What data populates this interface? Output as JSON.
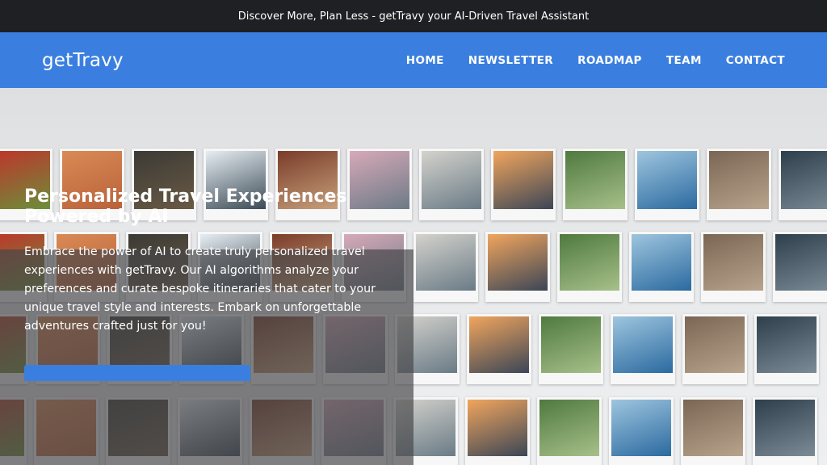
{
  "announcement": "Discover More, Plan Less - getTravy your AI-Driven Travel Assistant",
  "brand": "getTravy",
  "nav": [
    "HOME",
    "NEWSLETTER",
    "ROADMAP",
    "TEAM",
    "CONTACT"
  ],
  "hero": {
    "title": "Personalized Travel Experiences Powered by AI",
    "description": "Embrace the power of AI to create truly personalized travel experiences with getTravy. Our AI algorithms analyze your preferences and curate bespoke itineraries that cater to your unique travel style and interests. Embark on unforgettable adventures crafted just for you!"
  },
  "colors": {
    "topbar": "#1f2023",
    "navbar": "#3a7fe0",
    "accent": "#3a7fe0"
  }
}
